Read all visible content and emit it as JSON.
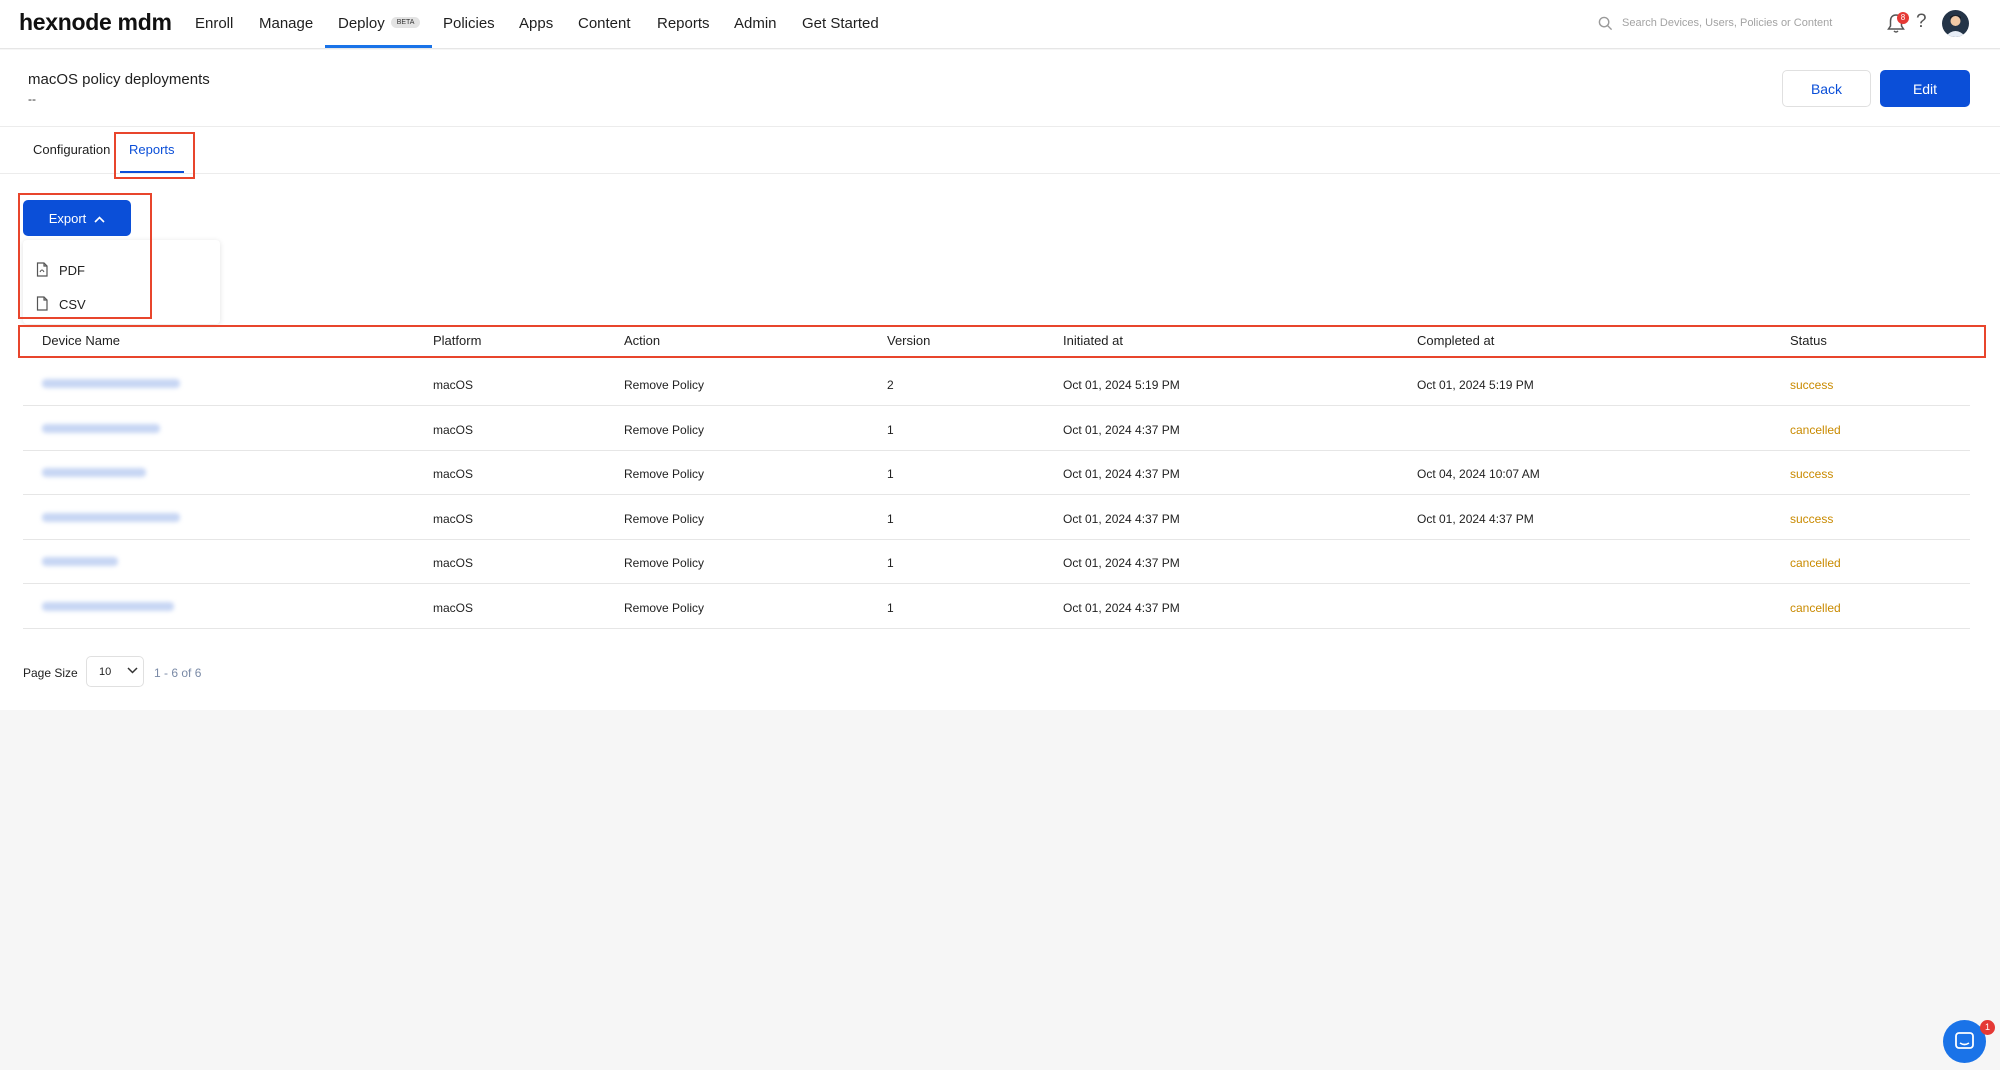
{
  "app": {
    "logo": "hexnode mdm"
  },
  "nav": {
    "items": [
      {
        "label": "Enroll"
      },
      {
        "label": "Manage"
      },
      {
        "label": "Deploy",
        "badge": "BETA",
        "active": true
      },
      {
        "label": "Policies"
      },
      {
        "label": "Apps"
      },
      {
        "label": "Content"
      },
      {
        "label": "Reports"
      },
      {
        "label": "Admin"
      },
      {
        "label": "Get Started"
      }
    ],
    "search_placeholder": "Search Devices, Users, Policies or Content",
    "notification_count": "8"
  },
  "page": {
    "title": "macOS policy deployments",
    "subtitle": "--",
    "back_label": "Back",
    "edit_label": "Edit"
  },
  "tabs": [
    {
      "label": "Configuration"
    },
    {
      "label": "Reports",
      "active": true
    }
  ],
  "export": {
    "label": "Export",
    "options": [
      {
        "label": "PDF",
        "icon": "pdf-file-icon"
      },
      {
        "label": "CSV",
        "icon": "csv-file-icon"
      }
    ]
  },
  "table": {
    "columns": [
      "Device Name",
      "Platform",
      "Action",
      "Version",
      "Initiated at",
      "Completed at",
      "Status"
    ],
    "rows": [
      {
        "platform": "macOS",
        "action": "Remove Policy",
        "version": "2",
        "initiated": "Oct 01, 2024 5:19 PM",
        "completed": "Oct 01, 2024 5:19 PM",
        "status": "success"
      },
      {
        "platform": "macOS",
        "action": "Remove Policy",
        "version": "1",
        "initiated": "Oct 01, 2024 4:37 PM",
        "completed": "",
        "status": "cancelled"
      },
      {
        "platform": "macOS",
        "action": "Remove Policy",
        "version": "1",
        "initiated": "Oct 01, 2024 4:37 PM",
        "completed": "Oct 04, 2024 10:07 AM",
        "status": "success"
      },
      {
        "platform": "macOS",
        "action": "Remove Policy",
        "version": "1",
        "initiated": "Oct 01, 2024 4:37 PM",
        "completed": "Oct 01, 2024 4:37 PM",
        "status": "success"
      },
      {
        "platform": "macOS",
        "action": "Remove Policy",
        "version": "1",
        "initiated": "Oct 01, 2024 4:37 PM",
        "completed": "",
        "status": "cancelled"
      },
      {
        "platform": "macOS",
        "action": "Remove Policy",
        "version": "1",
        "initiated": "Oct 01, 2024 4:37 PM",
        "completed": "",
        "status": "cancelled"
      }
    ]
  },
  "pagination": {
    "page_size_label": "Page Size",
    "page_size": "10",
    "range": "1 - 6 of 6"
  },
  "chat": {
    "badge": "1"
  },
  "colors": {
    "primary": "#0b4fd8",
    "status": "#c98a00",
    "highlight": "#e8452c"
  }
}
